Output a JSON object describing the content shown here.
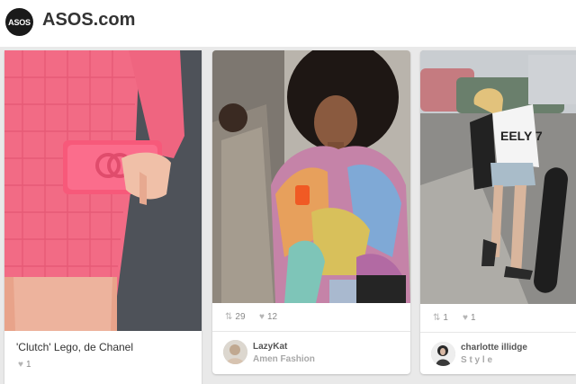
{
  "header": {
    "logo_text": "ASOS",
    "site_title": "ASOS.com"
  },
  "pins": [
    {
      "caption": "'Clutch' Lego, de Chanel",
      "likes": "1"
    },
    {
      "repins": "29",
      "likes": "12",
      "user": "LazyKat",
      "board": "Amen Fashion"
    },
    {
      "repins": "1",
      "likes": "1",
      "user": "charlotte illidge",
      "board": "S t y l e"
    }
  ],
  "shirt_text": "EELY 7",
  "icons": {
    "repin": "repin-icon",
    "like": "heart-icon"
  },
  "colors": {
    "header_bg": "#ffffff",
    "page_bg": "#e9e9e9",
    "pink_outfit": "#f26b85",
    "text_dark": "#333333",
    "text_muted": "#a8a8a8"
  }
}
